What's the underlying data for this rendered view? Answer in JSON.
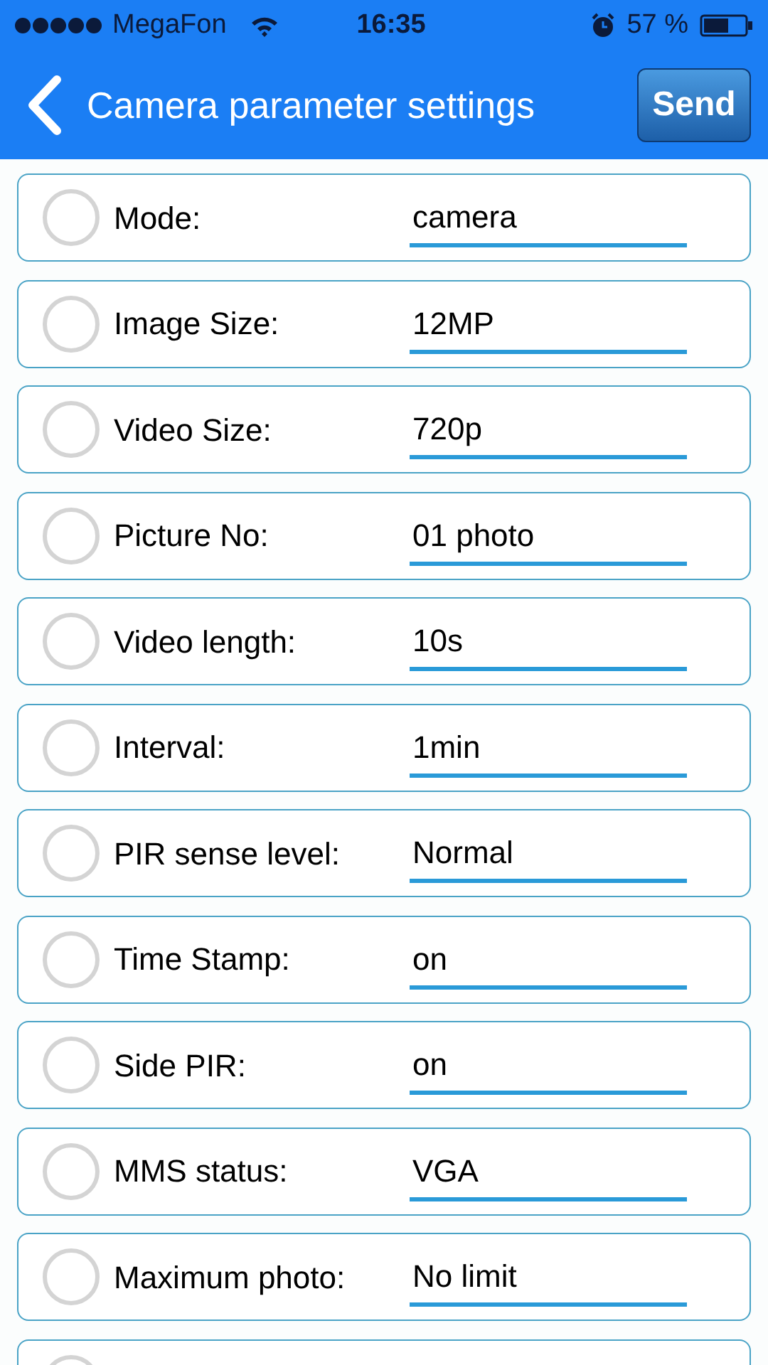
{
  "status_bar": {
    "carrier": "MegaFon",
    "time": "16:35",
    "battery": "57 %"
  },
  "nav": {
    "title": "Camera parameter settings",
    "action": "Send"
  },
  "rows": [
    {
      "label": "Mode:",
      "value": "camera",
      "checked": false
    },
    {
      "label": "Image Size:",
      "value": "12MP",
      "checked": false
    },
    {
      "label": "Video Size:",
      "value": "720p",
      "checked": false
    },
    {
      "label": "Picture No:",
      "value": "01 photo",
      "checked": false
    },
    {
      "label": "Video length:",
      "value": "10s",
      "checked": false
    },
    {
      "label": "Interval:",
      "value": "1min",
      "checked": false
    },
    {
      "label": "PIR sense level:",
      "value": "Normal",
      "checked": false
    },
    {
      "label": "Time Stamp:",
      "value": "on",
      "checked": false
    },
    {
      "label": "Side PIR:",
      "value": "on",
      "checked": false
    },
    {
      "label": "MMS status:",
      "value": "VGA",
      "checked": false
    },
    {
      "label": "Maximum photo:",
      "value": "No limit",
      "checked": false
    },
    {
      "checked": false
    }
  ]
}
